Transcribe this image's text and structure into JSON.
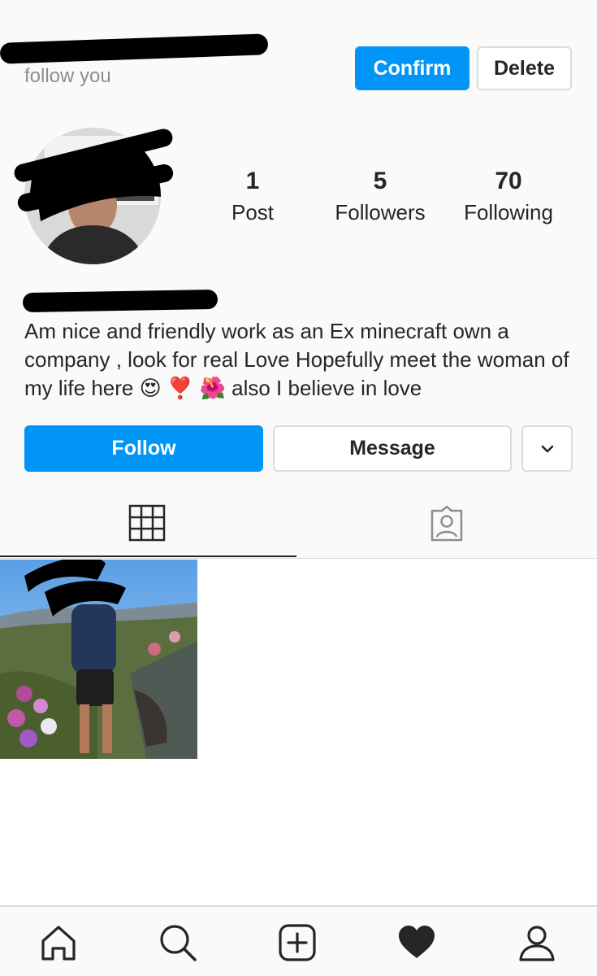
{
  "request": {
    "text": "follow you",
    "confirm_label": "Confirm",
    "delete_label": "Delete"
  },
  "stats": [
    {
      "value": "1",
      "label": "Post"
    },
    {
      "value": "5",
      "label": "Followers"
    },
    {
      "value": "70",
      "label": "Following"
    }
  ],
  "profile": {
    "bio": "Am nice and friendly work as an Ex minecraft own a company , look for real Love Hopefully meet the woman of my life here 😍 ❣️ 🌺 also I believe in love"
  },
  "actions": {
    "follow_label": "Follow",
    "message_label": "Message"
  },
  "tabs": [
    "grid-icon",
    "tagged-icon"
  ],
  "bottom_nav": [
    "home-icon",
    "search-icon",
    "new-post-icon",
    "activity-heart-icon",
    "profile-icon"
  ],
  "colors": {
    "accent": "#0095f6",
    "text": "#262626",
    "muted": "#8e8e8e",
    "border": "#dbdbdb",
    "background": "#fafafa"
  }
}
